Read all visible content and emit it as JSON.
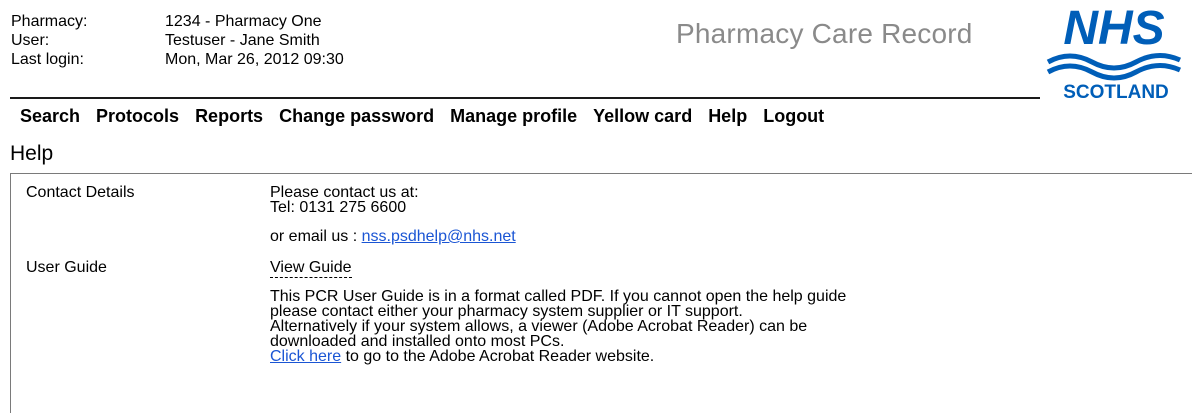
{
  "header": {
    "pharmacy_label": "Pharmacy:",
    "pharmacy_value": "1234 - Pharmacy One",
    "user_label": "User:",
    "user_value": "Testuser - Jane Smith",
    "last_login_label": "Last login:",
    "last_login_value": "Mon, Mar 26, 2012 09:30",
    "app_title": "Pharmacy Care Record",
    "logo_text_top": "NHS",
    "logo_text_bottom": "SCOTLAND",
    "logo_color": "#005eb8"
  },
  "nav": {
    "items": [
      "Search",
      "Protocols",
      "Reports",
      "Change password",
      "Manage profile",
      "Yellow card",
      "Help",
      "Logout"
    ]
  },
  "page": {
    "title": "Help"
  },
  "help": {
    "contact": {
      "label": "Contact Details",
      "line1": "Please contact us at:",
      "line2": "Tel: 0131 275 6600",
      "email_prefix": "or email us : ",
      "email": "nss.psdhelp@nhs.net"
    },
    "guide": {
      "label": "User Guide",
      "link": "View Guide",
      "desc_line1": "This PCR User Guide is in a format called PDF. If you cannot open the help guide",
      "desc_line2": "please contact either your pharmacy system supplier or IT support.",
      "desc_line3": "Alternatively if your system allows, a viewer (Adobe Acrobat Reader) can be",
      "desc_line4": "downloaded and installed onto most PCs.",
      "click_here": "Click here",
      "desc_line5_suffix": " to go to the Adobe Acrobat Reader website."
    }
  },
  "colors": {
    "link": "#1a55d4",
    "title_gray": "#8a8a8a"
  }
}
